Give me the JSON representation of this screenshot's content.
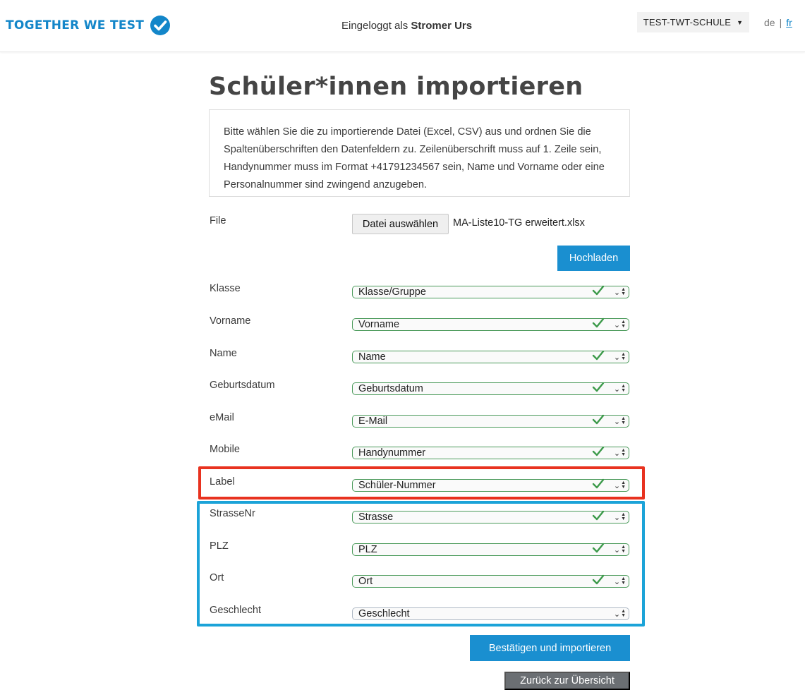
{
  "header": {
    "brand": "TOGETHER WE TEST",
    "logged_in_prefix": "Eingeloggt als",
    "logged_in_user": "Stromer Urs",
    "school": "TEST-TWT-SCHULE",
    "lang_de": "de",
    "lang_sep": "|",
    "lang_fr": "fr"
  },
  "page": {
    "title": "Schüler*innen importieren",
    "info": "Bitte wählen Sie die zu importierende Datei (Excel, CSV) aus und ordnen Sie die Spaltenüberschriften den Datenfeldern zu. Zeilenüberschrift muss auf 1. Zeile sein, Handynummer muss im Format +41791234567 sein, Name und Vorname oder eine Personalnummer sind zwingend anzugeben."
  },
  "file": {
    "label": "File",
    "choose_button": "Datei auswählen",
    "file_name": "MA-Liste10-TG erweitert.xlsx",
    "upload_button": "Hochladen"
  },
  "fields": [
    {
      "label": "Klasse",
      "value": "Klasse/Gruppe"
    },
    {
      "label": "Vorname",
      "value": "Vorname"
    },
    {
      "label": "Name",
      "value": "Name"
    },
    {
      "label": "Geburtsdatum",
      "value": "Geburtsdatum"
    },
    {
      "label": "eMail",
      "value": "E-Mail"
    },
    {
      "label": "Mobile",
      "value": "Handynummer"
    },
    {
      "label": "Label",
      "value": "Schüler-Nummer"
    },
    {
      "label": "StrasseNr",
      "value": "Strasse"
    },
    {
      "label": "PLZ",
      "value": "PLZ"
    },
    {
      "label": "Ort",
      "value": "Ort"
    },
    {
      "label": "Geschlecht",
      "value": "Geschlecht"
    }
  ],
  "actions": {
    "confirm": "Bestätigen und importieren",
    "back": "Zurück zur Übersicht"
  },
  "colors": {
    "brand": "#1386c9",
    "primary_button": "#1a8fd0",
    "secondary_button": "#6b6f73",
    "valid_border": "#4a9a5a",
    "highlight_red": "#e8321f",
    "highlight_blue": "#1ba3d8"
  }
}
